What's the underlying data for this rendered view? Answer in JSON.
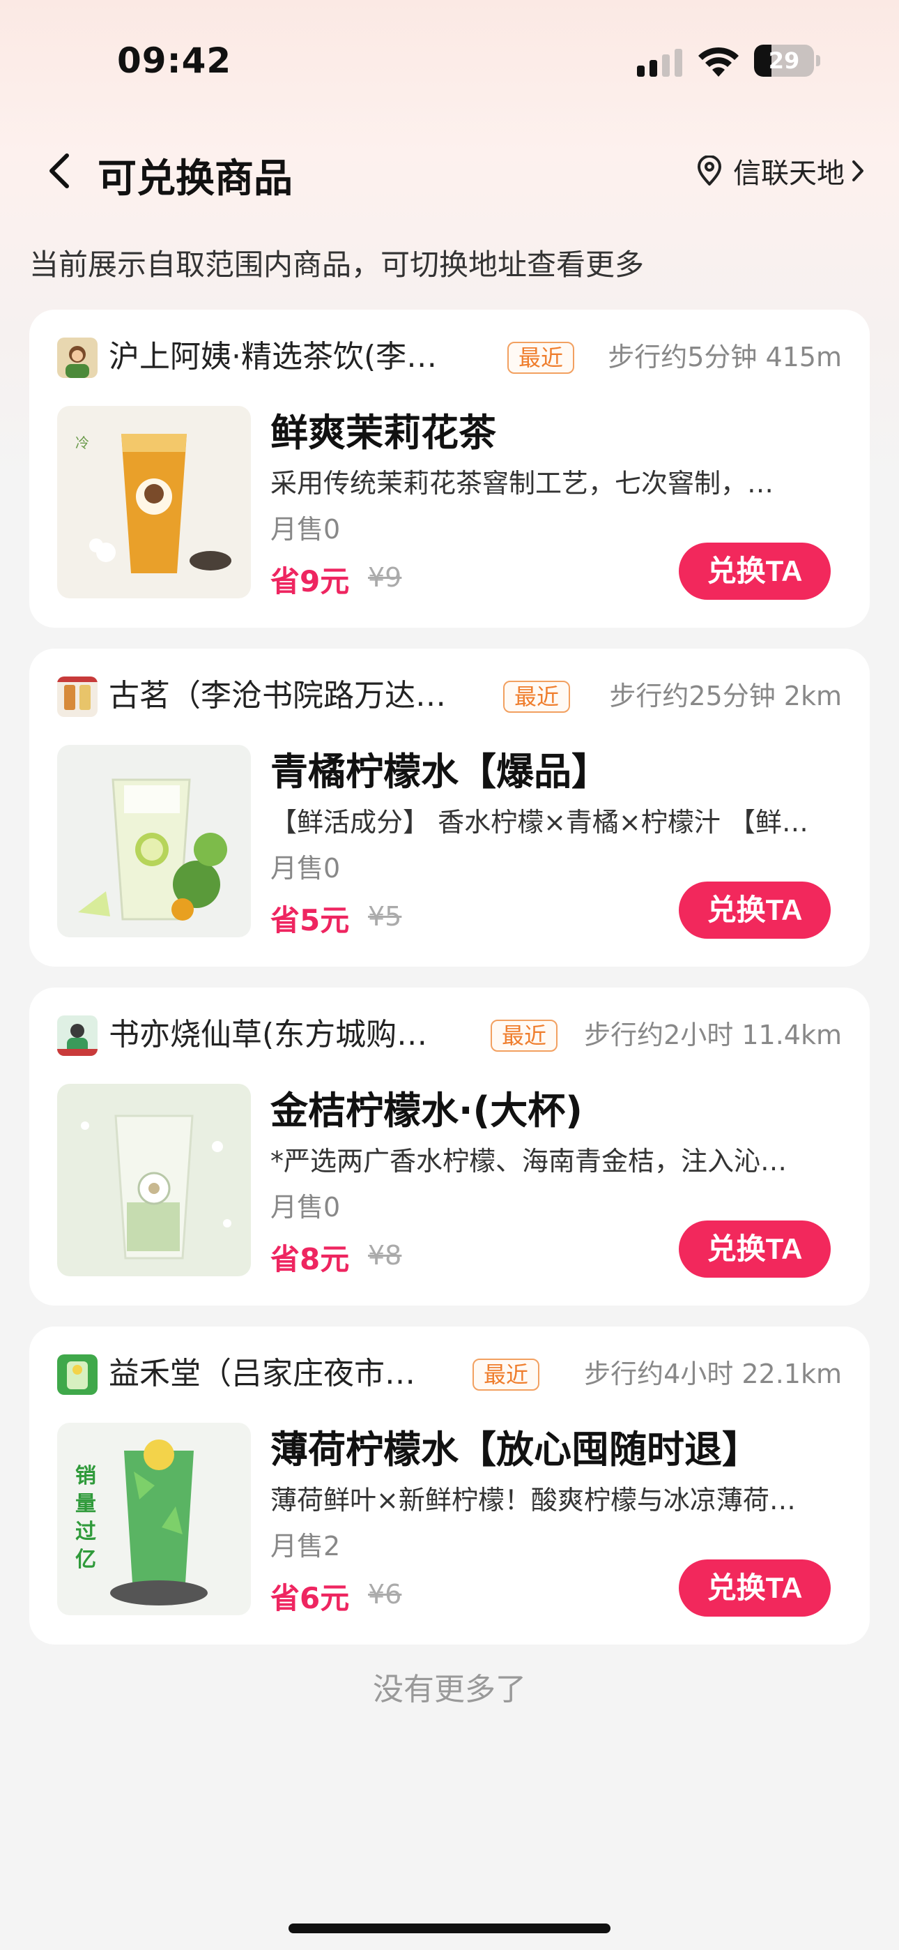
{
  "status_bar": {
    "time": "09:42",
    "battery": "29",
    "battery_level": 0.29,
    "icons": [
      "signal-icon",
      "wifi-icon",
      "battery-icon"
    ]
  },
  "header": {
    "title": "可兑换商品",
    "location": "信联天地",
    "icons": [
      "back-icon",
      "location-pin-icon",
      "chevron-right-icon"
    ]
  },
  "subtitle": "当前展示自取范围内商品，可切换地址查看更多",
  "products": [
    {
      "store": "沪上阿姨·精选茶饮(李…",
      "badge": "最近",
      "distance": "步行约5分钟 415m",
      "name": "鲜爽茉莉花茶",
      "desc": "采用传统茉莉花茶窨制工艺，七次窨制，…",
      "sales": "月售0",
      "save": "省9元",
      "orig": "¥9",
      "button": "兑换TA",
      "theme": "#e9a02a"
    },
    {
      "store": "古茗（李沧书院路万达…",
      "badge": "最近",
      "distance": "步行约25分钟 2km",
      "name": "青橘柠檬水【爆品】",
      "desc": "【鲜活成分】 香水柠檬×青橘×柠檬汁 【鲜…",
      "sales": "月售0",
      "save": "省5元",
      "orig": "¥5",
      "button": "兑换TA",
      "theme": "#9cc95a"
    },
    {
      "store": "书亦烧仙草(东方城购…",
      "badge": "最近",
      "distance": "步行约2小时 11.4km",
      "name": "金桔柠檬水·(大杯)",
      "desc": "*严选两广香水柠檬、海南青金桔，注入沁…",
      "sales": "月售0",
      "save": "省8元",
      "orig": "¥8",
      "button": "兑换TA",
      "theme": "#c9dcb8"
    },
    {
      "store": "益禾堂（吕家庄夜市…",
      "badge": "最近",
      "distance": "步行约4小时 22.1km",
      "name": "薄荷柠檬水【放心囤随时退】",
      "desc": "薄荷鲜叶×新鲜柠檬！酸爽柠檬与冰凉薄荷…",
      "sales": "月售2",
      "save": "省6元",
      "orig": "¥6",
      "button": "兑换TA",
      "theme": "#3fa84a",
      "image_text": [
        "销",
        "量",
        "过",
        "亿"
      ]
    }
  ],
  "footer": "没有更多了"
}
